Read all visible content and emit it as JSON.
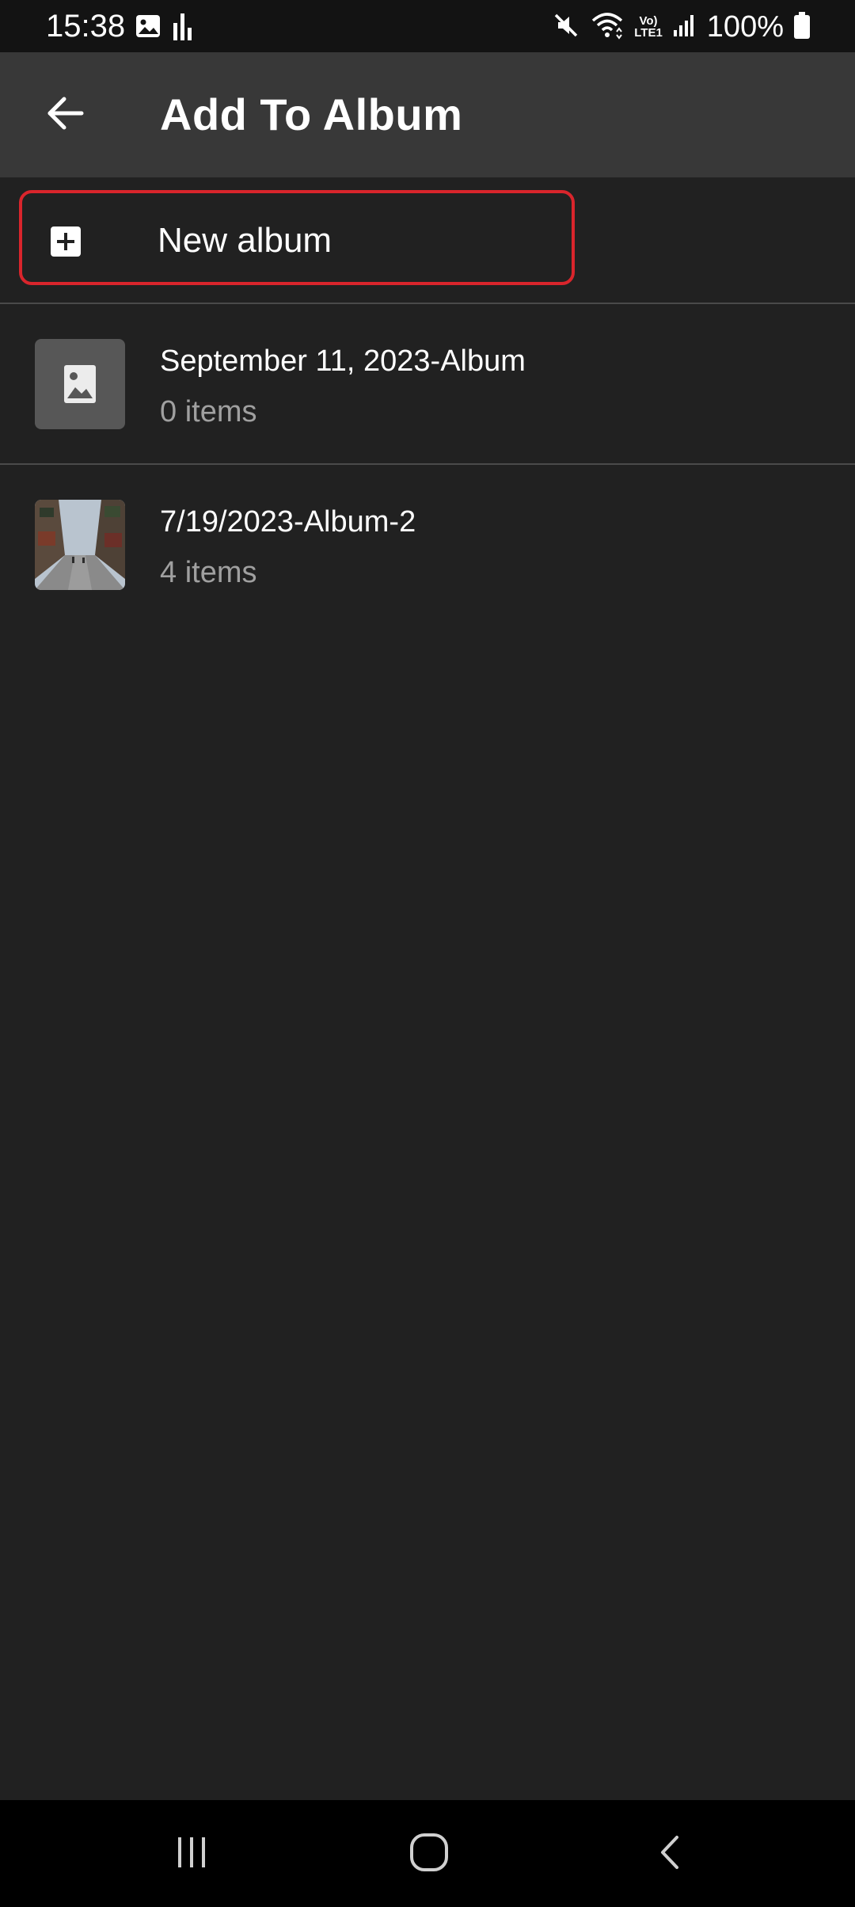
{
  "status_bar": {
    "time": "15:38",
    "battery": "100%",
    "left_icons": [
      "image-icon",
      "bars-icon"
    ],
    "right_icons": [
      "mute-icon",
      "wifi-icon",
      "volte-icon",
      "signal-icon",
      "battery-icon"
    ],
    "volte_text_top": "Vo)",
    "volte_text_bottom": "LTE1"
  },
  "app_bar": {
    "title": "Add To Album",
    "back_icon": "arrow-back-icon"
  },
  "new_album": {
    "label": "New album",
    "icon": "add-box-icon",
    "highlight_color": "#d9252c"
  },
  "albums": [
    {
      "name": "September 11, 2023-Album",
      "count": "0 items",
      "thumbnail": "image-placeholder-icon"
    },
    {
      "name": "7/19/2023-Album-2",
      "count": "4 items",
      "thumbnail": "street-photo"
    }
  ],
  "nav_bar": {
    "items": [
      "recent-apps-icon",
      "home-icon",
      "back-icon"
    ]
  },
  "colors": {
    "background": "#212121",
    "app_bar": "#383838",
    "status_bar": "#131313",
    "nav_bar": "#000000",
    "secondary_text": "#a0a0a0"
  }
}
